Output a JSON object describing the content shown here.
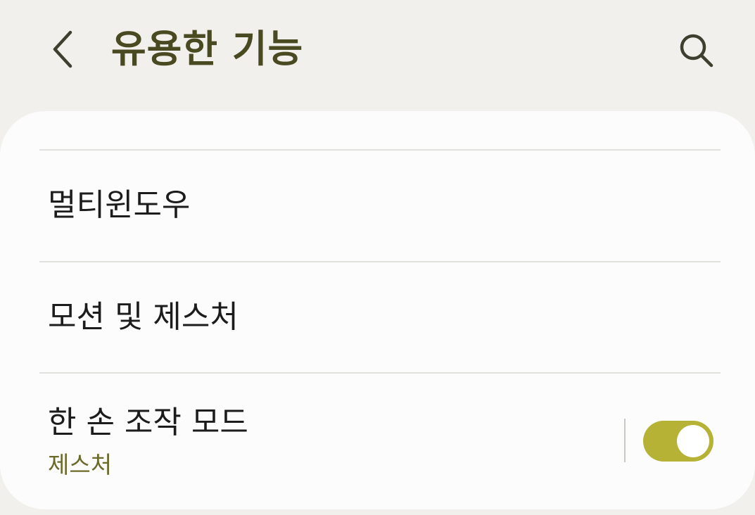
{
  "header": {
    "title": "유용한 기능",
    "back_icon": "chevron-left-icon",
    "search_icon": "search-icon"
  },
  "list": {
    "items": [
      {
        "label": "멀티윈도우"
      },
      {
        "label": "모션 및 제스처"
      },
      {
        "label": "한 손 조작 모드",
        "sublabel": "제스처",
        "toggle_on": true
      }
    ]
  },
  "colors": {
    "background": "#f1f0ec",
    "card": "#fcfcfc",
    "title": "#4a4a22",
    "accent": "#b5b235",
    "sublabel": "#6b6a2a"
  }
}
